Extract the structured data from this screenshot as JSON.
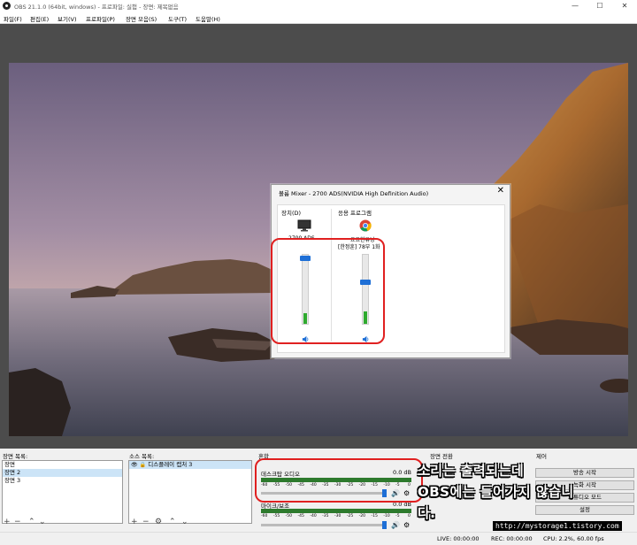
{
  "window": {
    "title": "OBS 21.1.0 (64bit, windows) - 프로파일: 실험 - 장면: 제목없음",
    "min_label": "—",
    "max_label": "☐",
    "close_label": "✕"
  },
  "menu": [
    {
      "label": "파일(F)"
    },
    {
      "label": "편집(E)"
    },
    {
      "label": "보기(V)"
    },
    {
      "label": "프로파일(P)"
    },
    {
      "label": "장면 모음(S)"
    },
    {
      "label": "도구(T)"
    },
    {
      "label": "도움말(H)"
    }
  ],
  "mixer": {
    "title": "볼륨 Mixer - 2700 ADS(NVIDIA High Definition Audio)",
    "close_label": "✕",
    "device_section": "장치(D)",
    "app_section": "응용 프로그램",
    "device_name": "2700 ADS",
    "app_name_line1": "요요한유닝",
    "app_name_line2": "[한정훈] 78부 1화",
    "device_level": 0.15,
    "app_level": 0.18
  },
  "docks": {
    "scenes_title": "장면 목록:",
    "sources_title": "소스 목록:",
    "mixer_title": "혼합",
    "transition_title": "장면 전환",
    "controls_title": "제어"
  },
  "scenes": [
    "장면",
    "장면 2",
    "장면 3"
  ],
  "selected_scene": 1,
  "sources": [
    "디스플레이 캡처 3"
  ],
  "audio": [
    {
      "name": "데스크탑 오디오",
      "db": "0.0 dB"
    },
    {
      "name": "마이크/보조",
      "db": "0.0 dB"
    }
  ],
  "meter_ticks": [
    "-60",
    "-55",
    "-50",
    "-45",
    "-40",
    "-35",
    "-30",
    "-25",
    "-20",
    "-15",
    "-10",
    "-5",
    "0"
  ],
  "controls": {
    "start_stream": "방송 시작",
    "start_record": "녹화 시작",
    "studio_mode": "스튜디오 모드",
    "settings": "설정"
  },
  "overlay_text": {
    "line1": "소리는 출력되는데",
    "line2": "OBS에는 들어가지 않습니",
    "line3": "다."
  },
  "watermark": "http://mystorage1.tistory.com",
  "status": {
    "live": "LIVE: 00:00:00",
    "rec": "REC: 00:00:00",
    "cpu": "CPU: 2.2%, 60.00 fps"
  },
  "colors": {
    "accent": "#1e6fd6",
    "annotation": "#e02020",
    "meter_green": "#2faa2f"
  }
}
